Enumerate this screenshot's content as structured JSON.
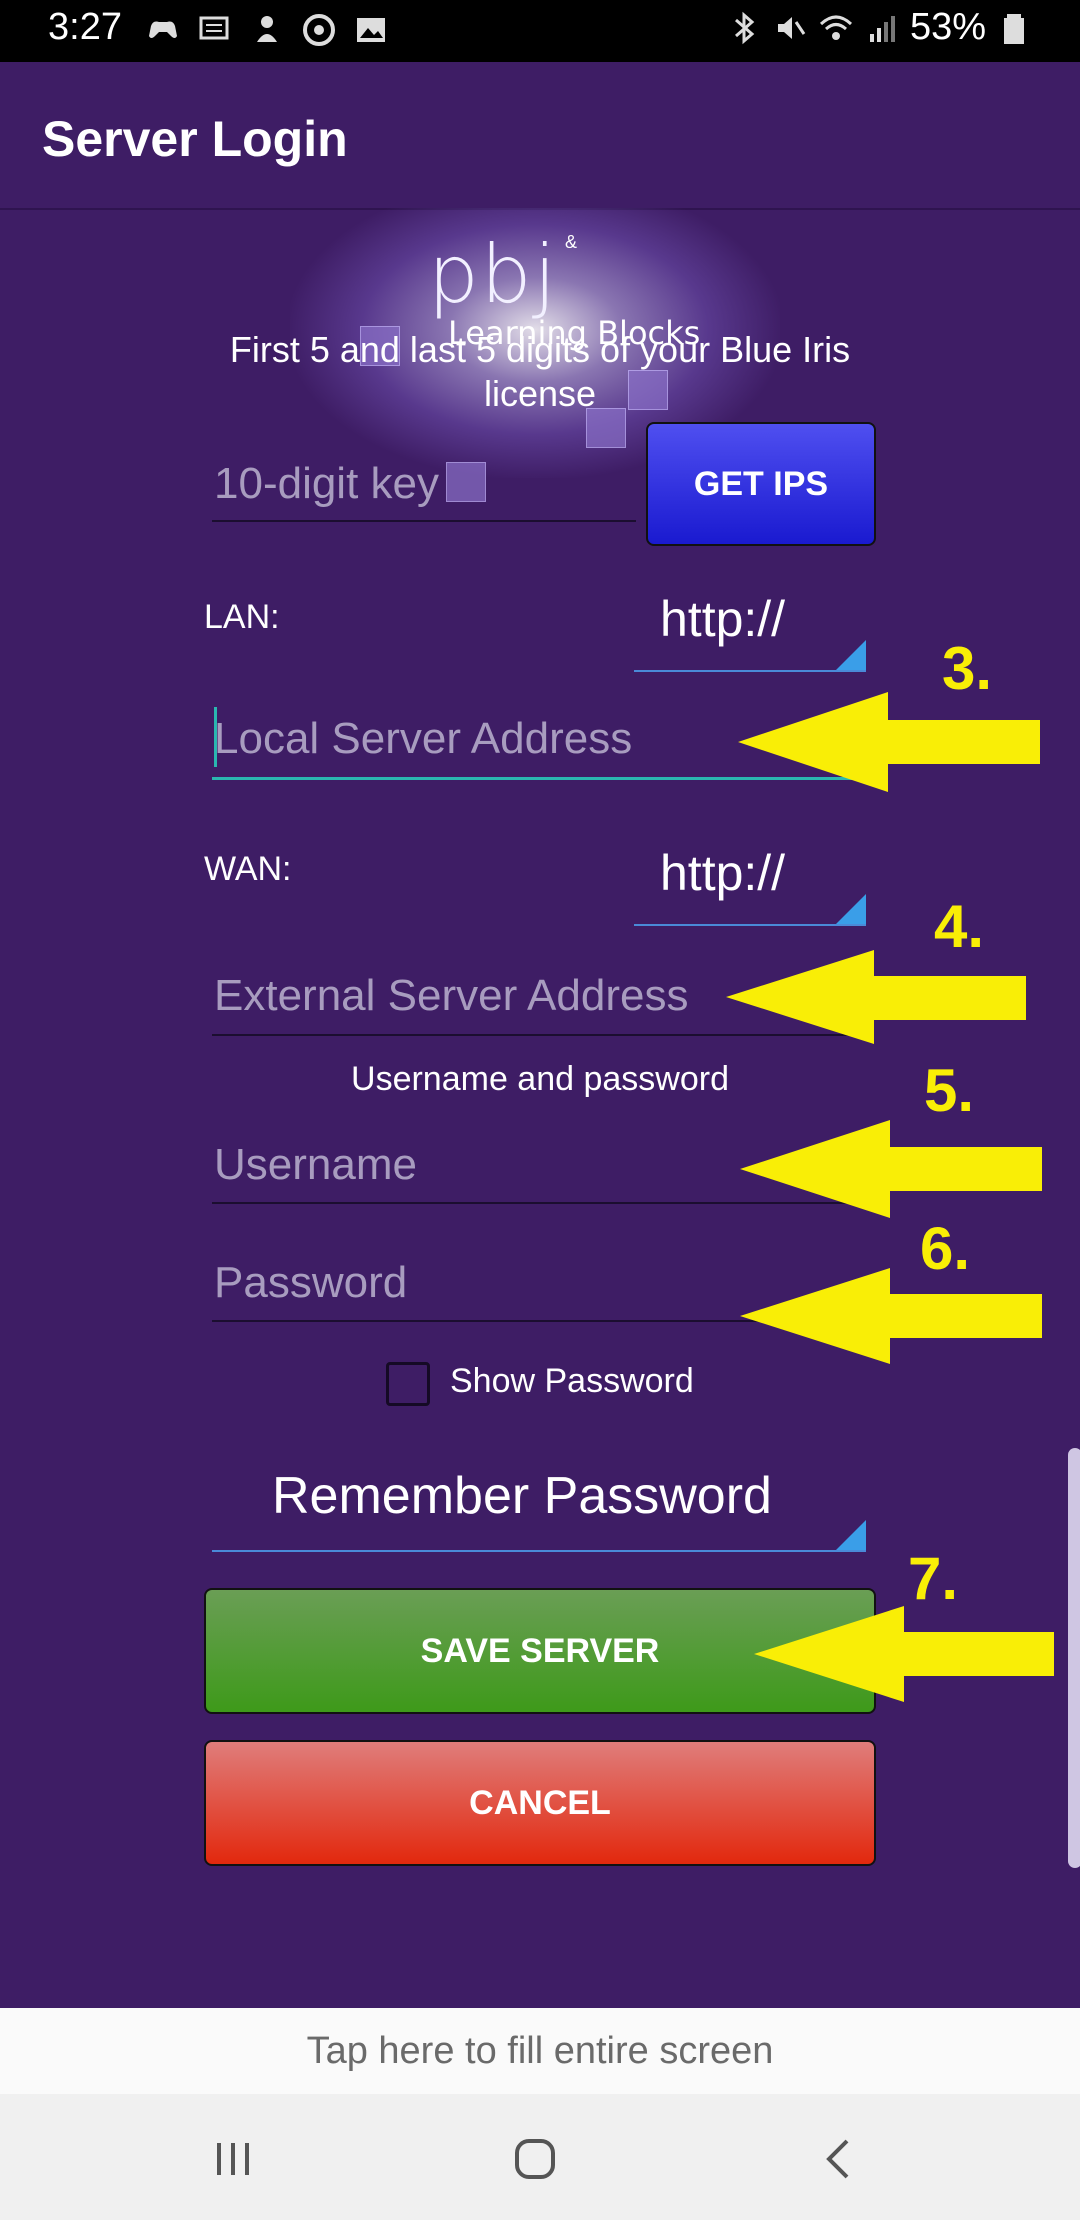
{
  "status_bar": {
    "time": "3:27",
    "battery": "53%"
  },
  "app_bar": {
    "title": "Server Login"
  },
  "logo": {
    "brand": "pbj",
    "ampersand": "&",
    "subtitle": "Learning Blocks"
  },
  "license": {
    "instructions": "First 5 and last 5 digits of your Blue Iris license",
    "key_placeholder": "10-digit key",
    "get_ips_label": "GET IPS"
  },
  "lan": {
    "label": "LAN:",
    "protocol": "http://",
    "placeholder": "Local Server Address"
  },
  "wan": {
    "label": "WAN:",
    "protocol": "http://",
    "placeholder": "External Server Address"
  },
  "credentials": {
    "section_label": "Username and password",
    "username_placeholder": "Username",
    "password_placeholder": "Password",
    "show_password_label": "Show Password",
    "remember_option": "Remember Password"
  },
  "actions": {
    "save_label": "SAVE SERVER",
    "cancel_label": "CANCEL"
  },
  "annotations": {
    "steps": [
      "3.",
      "4.",
      "5.",
      "6.",
      "7."
    ],
    "color": "#f9ee06"
  },
  "banner": {
    "fill_screen": "Tap here to fill entire screen"
  },
  "colors": {
    "background": "#3e1d65",
    "accent_focus": "#2ab7b0",
    "get_ips_button": "#2a2ae0",
    "save_button": "#4a9a28",
    "cancel_button": "#e2341a"
  }
}
